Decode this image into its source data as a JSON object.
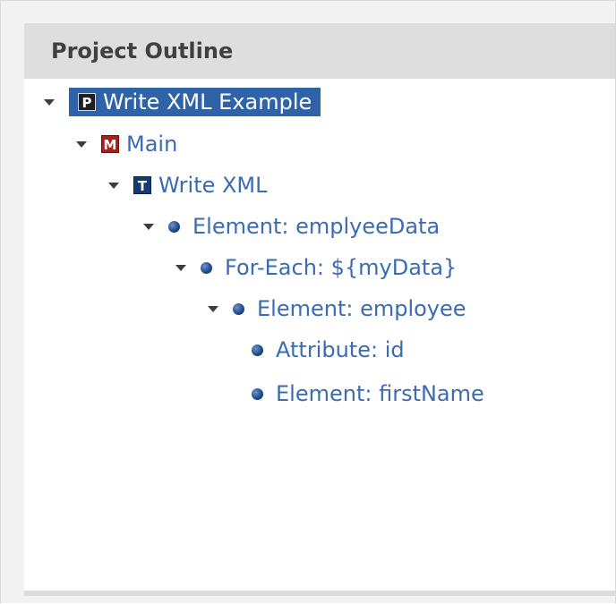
{
  "panel": {
    "title": "Project Outline"
  },
  "tree": {
    "project": "Write XML Example",
    "module": "Main",
    "task": "Write XML",
    "element_1": "Element: emplyeeData",
    "for_each": "For-Each: ${myData}",
    "element_2": "Element: employee",
    "attribute_1": "Attribute: id",
    "element_3": "Element: firstName"
  },
  "badges": {
    "project": "P",
    "module": "M",
    "task": "T"
  },
  "colors": {
    "selection": "#2e63a8",
    "link_text": "#3b6bb2",
    "header_bg": "#dedede"
  }
}
